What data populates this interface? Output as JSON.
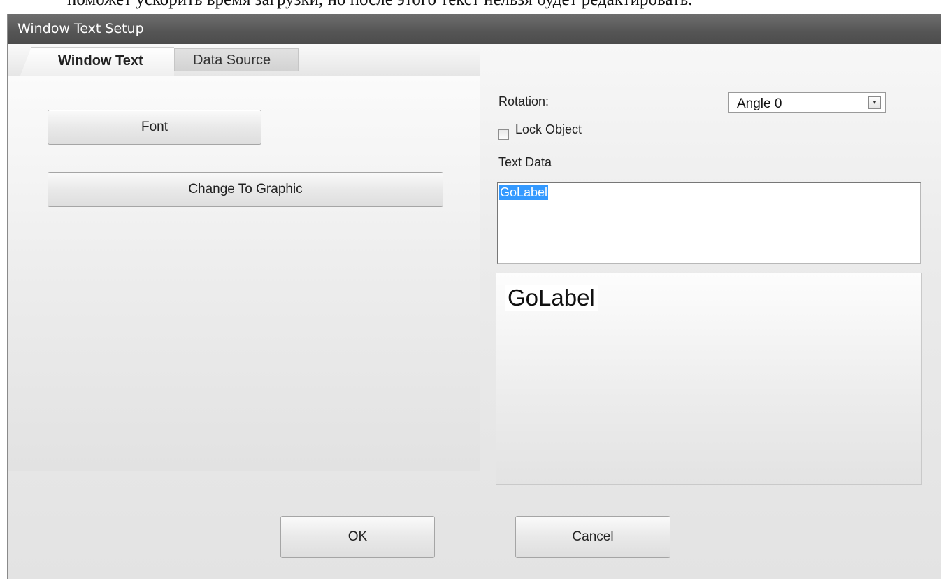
{
  "document_caption": "поможет ускорить время загрузки, но после этого текст нельзя будет редактировать.",
  "window": {
    "title": "Window Text Setup"
  },
  "tabs": [
    {
      "label": "Window Text",
      "active": true
    },
    {
      "label": "Data Source",
      "active": false
    }
  ],
  "left_panel": {
    "font_button": "Font",
    "change_to_graphic_button": "Change To Graphic"
  },
  "right_panel": {
    "rotation_label": "Rotation:",
    "rotation_value": "Angle 0",
    "dropdown_arrow": "▼",
    "lock_object_label": "Lock Object",
    "lock_object_checked": false,
    "text_data_label": "Text Data",
    "text_data_value": "GoLabel",
    "preview_text": "GoLabel"
  },
  "footer": {
    "ok_button": "OK",
    "cancel_button": "Cancel"
  }
}
